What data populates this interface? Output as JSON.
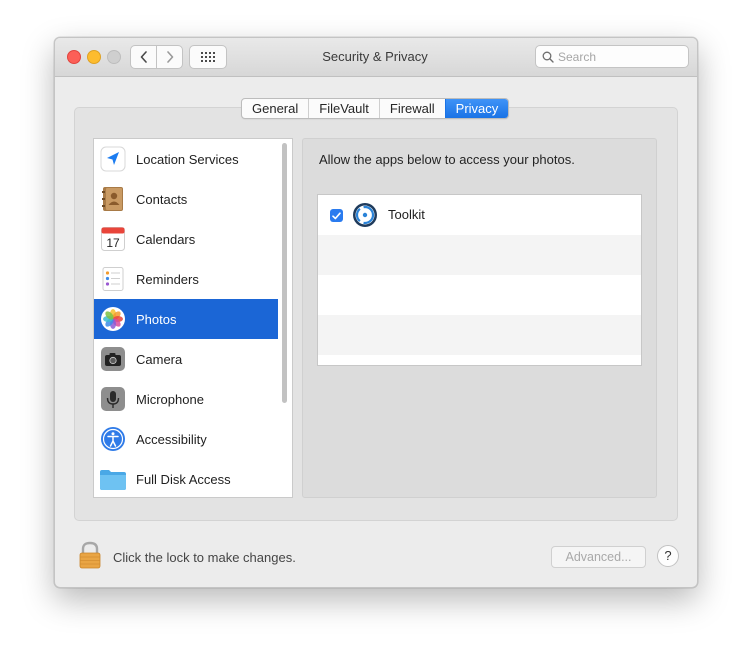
{
  "window": {
    "title": "Security & Privacy",
    "search_placeholder": "Search"
  },
  "tabs": [
    {
      "label": "General",
      "active": false
    },
    {
      "label": "FileVault",
      "active": false
    },
    {
      "label": "Firewall",
      "active": false
    },
    {
      "label": "Privacy",
      "active": true
    }
  ],
  "sidebar": {
    "items": [
      {
        "label": "Location Services",
        "icon": "location-arrow-icon"
      },
      {
        "label": "Contacts",
        "icon": "contacts-book-icon"
      },
      {
        "label": "Calendars",
        "icon": "calendar-icon",
        "icon_text": "17"
      },
      {
        "label": "Reminders",
        "icon": "reminders-icon"
      },
      {
        "label": "Photos",
        "icon": "photos-icon",
        "selected": true
      },
      {
        "label": "Camera",
        "icon": "camera-icon"
      },
      {
        "label": "Microphone",
        "icon": "microphone-icon"
      },
      {
        "label": "Accessibility",
        "icon": "accessibility-icon"
      },
      {
        "label": "Full Disk Access",
        "icon": "folder-icon"
      }
    ]
  },
  "main": {
    "description": "Allow the apps below to access your photos.",
    "apps": [
      {
        "name": "Toolkit",
        "checked": true,
        "icon": "toolkit-app-icon"
      }
    ]
  },
  "footer": {
    "lock_text": "Click the lock to make changes.",
    "advanced_label": "Advanced...",
    "help_label": "?"
  },
  "colors": {
    "accent": "#1b66d6",
    "tab_active": "#2a7bef"
  }
}
